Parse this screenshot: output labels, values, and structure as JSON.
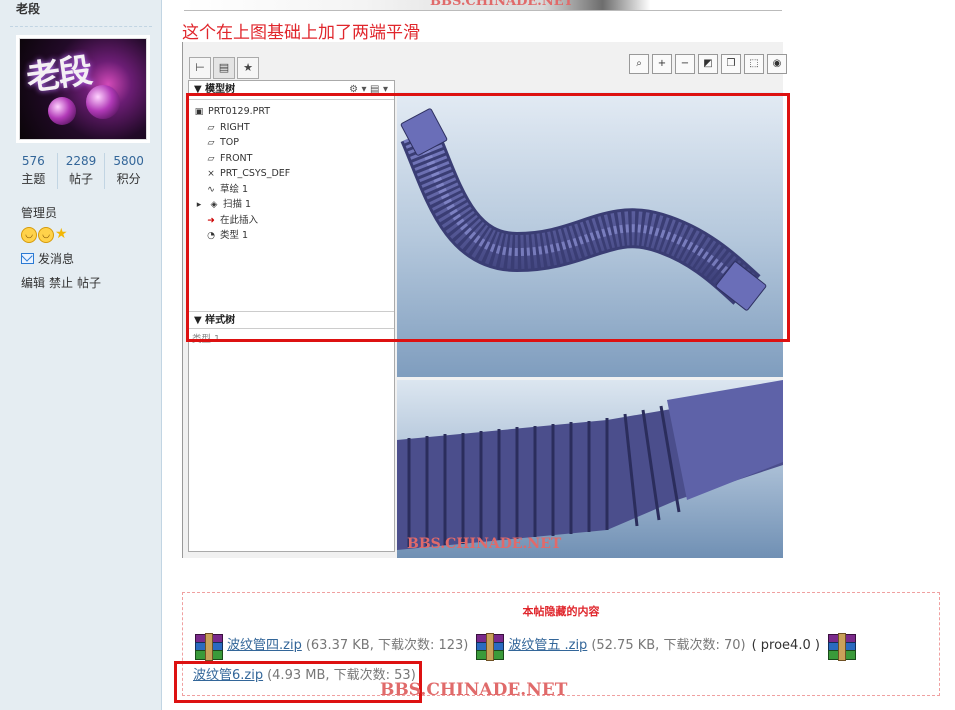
{
  "profile": {
    "username": "老段",
    "avatar_text": "老段",
    "stats": [
      {
        "value": "576",
        "label": "主题"
      },
      {
        "value": "2289",
        "label": "帖子"
      },
      {
        "value": "5800",
        "label": "积分"
      }
    ],
    "role": "管理员",
    "send_message": "发消息",
    "admin_links": [
      "编辑",
      "禁止",
      "帖子"
    ]
  },
  "post": {
    "top_watermark": "BBS.CHINADE.NET",
    "caption": "这个在上图基础上加了两端平滑",
    "screenshot": {
      "model_tree_title": "模型树",
      "style_tree_title": "样式树",
      "tree_items": [
        {
          "icon": "part-icon",
          "label": "PRT0129.PRT"
        },
        {
          "icon": "datum-plane-icon",
          "label": "RIGHT"
        },
        {
          "icon": "datum-plane-icon",
          "label": "TOP"
        },
        {
          "icon": "datum-plane-icon",
          "label": "FRONT"
        },
        {
          "icon": "csys-icon",
          "label": "PRT_CSYS_DEF"
        },
        {
          "icon": "sketch-icon",
          "label": "草绘 1"
        },
        {
          "icon": "sweep-icon",
          "label": "扫描 1"
        },
        {
          "icon": "insert-here-icon",
          "label": "在此插入"
        },
        {
          "icon": "style-icon",
          "label": "类型 1"
        }
      ],
      "style_ghost": "类型 1",
      "watermark": "BBS.CHINADE.NET"
    },
    "hidden_title": "本帖隐藏的内容",
    "attachments": [
      {
        "name": "波纹管四.zip",
        "meta": "(63.37 KB, 下载次数: 123)"
      },
      {
        "name": "波纹管五 .zip",
        "meta": "(52.75 KB, 下载次数: 70)"
      },
      {
        "name": "波纹管6.zip",
        "meta": "(4.93 MB, 下载次数: 53)"
      }
    ],
    "attachment_note": "( proe4.0 )",
    "bottom_watermark": "BBS.CHINADE.NET"
  }
}
